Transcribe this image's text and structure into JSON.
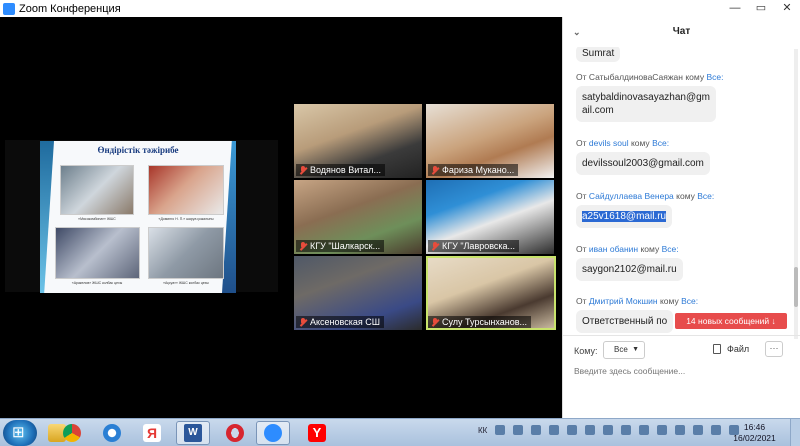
{
  "window": {
    "title": "Zoom Конференция",
    "controls": [
      "—",
      "▭",
      "✕"
    ]
  },
  "slide": {
    "title": "Өндірістік тәжірибе",
    "captions": [
      "«Мясокомбинат» ЖШС",
      "«Доминго Н. П.» шаруа қожалығы",
      "«Аракелов» ЖШС колбас цехы",
      "«Ақсуат» ЖШС колбас цехы"
    ]
  },
  "participants": [
    {
      "name": "Водянов Витал..."
    },
    {
      "name": "Фариза Мукано..."
    },
    {
      "name": "КГУ \"Шалкарск..."
    },
    {
      "name": "КГУ \"Лавровска..."
    },
    {
      "name": "Аксеновская СШ"
    },
    {
      "name": "Сулу Турсынханов..."
    }
  ],
  "chat": {
    "title": "Чат",
    "collapse_icon": "chevron-down-icon",
    "partial_top": "Sumrat",
    "messages": [
      {
        "from_prefix": "От",
        "sender": "СатыбалдиноваСаяжан",
        "to_text": "кому",
        "recipient": "Все:",
        "text_line1": "satybaldinovasayazhan@gm",
        "text_line2": "ail.com"
      },
      {
        "from_prefix": "От",
        "sender": "devils soul",
        "to_text": "кому",
        "recipient": "Все:",
        "text_line1": "devilssoul2003@gmail.com",
        "text_line2": ""
      },
      {
        "from_prefix": "От",
        "sender": "Сайдуллаева Венера",
        "to_text": "кому",
        "recipient": "Все:",
        "text_line1": "a25v1618@mail.ru",
        "text_line2": ""
      },
      {
        "from_prefix": "От",
        "sender": "иван обанин",
        "to_text": "кому",
        "recipient": "Все:",
        "text_line1": "saygon2102@mail.ru",
        "text_line2": ""
      },
      {
        "from_prefix": "От",
        "sender": "Дмитрий Мокшин",
        "to_text": "кому",
        "recipient": "Все:",
        "text_line1": "Ответственный по",
        "text_line2": ""
      }
    ],
    "new_messages": "14 новых сообщений ↓",
    "to_label": "Кому:",
    "to_value": "Все",
    "file_label": "Файл",
    "more_label": "···",
    "input_placeholder": "Введите здесь сообщение..."
  },
  "taskbar": {
    "apps": [
      "windows-explorer",
      "chrome",
      "internet-explorer",
      "yandex-browser",
      "word",
      "opera",
      "zoom",
      "yandex"
    ],
    "lang": "КК",
    "time": "16:46",
    "date": "16/02/2021"
  },
  "colors": {
    "accent": "#2d7ad6",
    "alert": "#e74c4c",
    "active_speaker": "#c8e36b"
  }
}
